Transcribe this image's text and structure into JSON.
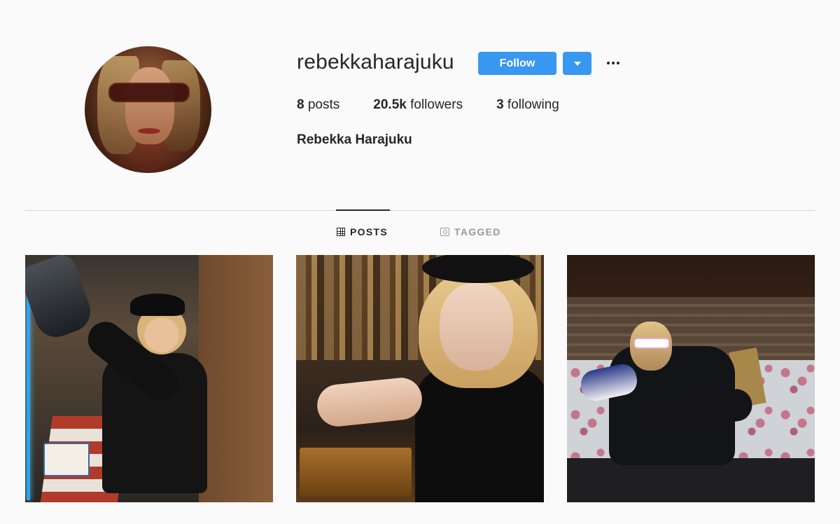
{
  "profile": {
    "username": "rebekkaharajuku",
    "full_name": "Rebekka Harajuku",
    "follow_label": "Follow"
  },
  "stats": {
    "posts_count": "8",
    "posts_label": " posts",
    "followers_count": "20.5k",
    "followers_label": " followers",
    "following_count": "3",
    "following_label": " following"
  },
  "tabs": [
    {
      "label": "POSTS",
      "icon": "grid-icon",
      "active": true
    },
    {
      "label": "TAGGED",
      "icon": "tag-user-icon",
      "active": false
    }
  ],
  "colors": {
    "accent": "#3897f0",
    "text": "#262626",
    "muted": "#999999",
    "background": "#fafafa",
    "divider": "#dbdbdb"
  }
}
